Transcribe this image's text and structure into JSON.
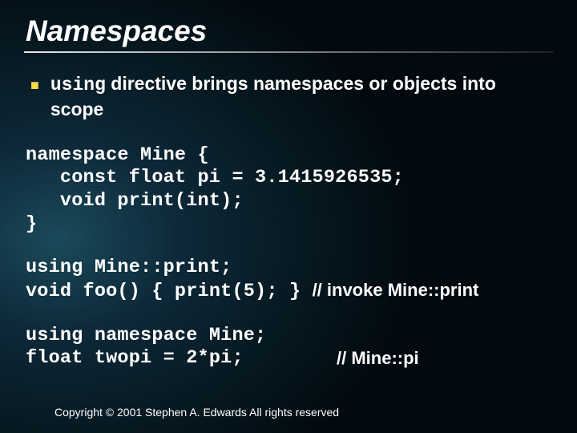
{
  "title": "Namespaces",
  "bullet": {
    "code_word": "using",
    "rest": " directive brings namespaces or objects into scope"
  },
  "code_block_1": "namespace Mine {\n   const float pi = 3.1415926535;\n   void print(int);\n}",
  "code_block_2": {
    "line1": "using Mine::print;",
    "line2_code": "void foo() { print(5); } ",
    "line2_comment": "// invoke Mine::print"
  },
  "code_block_3": {
    "code": "using namespace Mine;\nfloat twopi = 2*pi;",
    "comment": "// Mine::pi"
  },
  "copyright": "Copyright © 2001 Stephen A. Edwards  All rights reserved"
}
